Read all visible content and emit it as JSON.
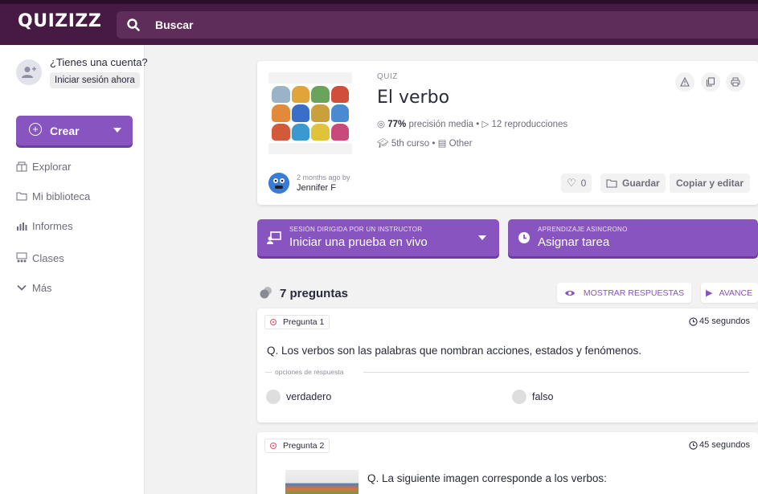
{
  "header": {
    "logo": "QUIZIZZ",
    "search_label": "Buscar"
  },
  "sidebar": {
    "account_question": "¿Tienes una cuenta?",
    "login_label": "Iniciar sesión ahora",
    "create_label": "Crear",
    "items": [
      {
        "label": "Explorar",
        "icon": "explore-icon"
      },
      {
        "label": "Mi biblioteca",
        "icon": "folder-icon"
      },
      {
        "label": "Informes",
        "icon": "reports-icon"
      },
      {
        "label": "Clases",
        "icon": "classes-icon"
      },
      {
        "label": "Más",
        "icon": "chevron-down-icon"
      }
    ]
  },
  "quiz": {
    "type": "QUIZ",
    "title": "El verbo",
    "accuracy": "77%",
    "accuracy_label": "precisión media",
    "plays": "12 reproducciones",
    "grade": "5th curso",
    "subject": "Other",
    "author_ago": "2 months ago by",
    "author_name": "Jennifer F",
    "likes": "0",
    "save_label": "Guardar",
    "copy_label": "Copiar y editar"
  },
  "actions": {
    "live": {
      "small": "SESIÓN DIRIGIDA POR UN INSTRUCTOR",
      "big": "Iniciar una prueba en vivo"
    },
    "homework": {
      "small": "APRENDIZAJE ASINCRONO",
      "big": "Asignar tarea"
    }
  },
  "questions_header": {
    "count": "7 preguntas",
    "show_answers": "MOSTRAR RESPUESTAS",
    "advance": "AVANCE"
  },
  "questions": [
    {
      "tag": "Pregunta 1",
      "time": "45 segundos",
      "text": "Q. Los verbos son las palabras que nombran acciones, estados y fenómenos.",
      "options_label": "opciones de respuesta",
      "options": [
        "verdadero",
        "falso"
      ]
    },
    {
      "tag": "Pregunta 2",
      "time": "45 segundos",
      "text": "Q. La siguiente imagen corresponde a los verbos:"
    }
  ],
  "colors": {
    "header_bg": "#461a42",
    "search_bg": "#5e2d5a",
    "accent": "#8854c0",
    "question_marker": "#e54d6b"
  }
}
